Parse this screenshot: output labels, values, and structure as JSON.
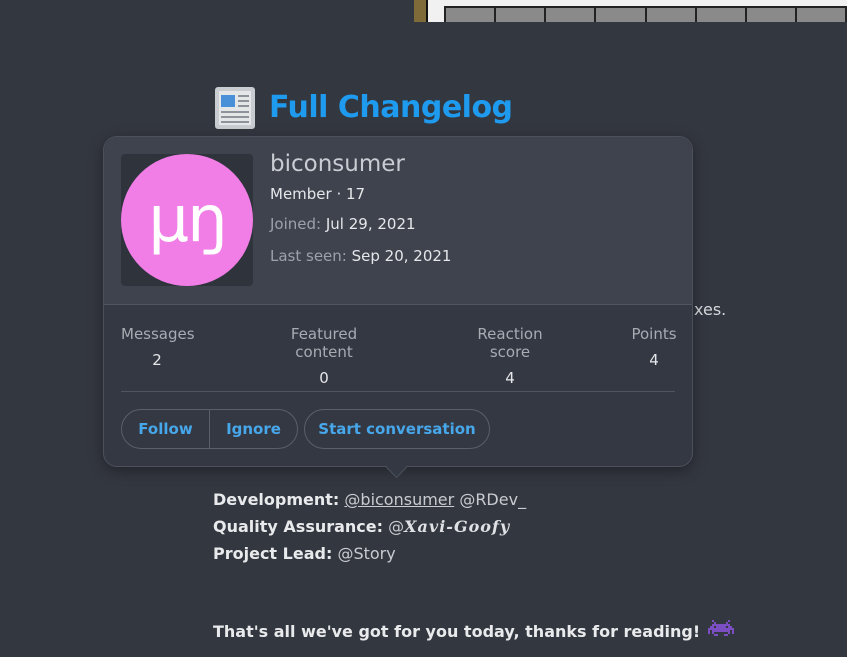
{
  "changelog": {
    "title": "Full Changelog",
    "icon": "newspaper-icon"
  },
  "background_text": {
    "fragment": "xes."
  },
  "profile_card": {
    "username": "biconsumer",
    "avatar_glyph": "μŋ",
    "avatar_color": "#f07ee6",
    "member_line": "Member · 17",
    "joined_label": "Joined:",
    "joined_value": "Jul 29, 2021",
    "last_seen_label": "Last seen:",
    "last_seen_value": "Sep 20, 2021",
    "stats": [
      {
        "label": "Messages",
        "value": "2"
      },
      {
        "label": "Featured content",
        "value": "0"
      },
      {
        "label": "Reaction score",
        "value": "4"
      },
      {
        "label": "Points",
        "value": "4"
      }
    ],
    "buttons": {
      "follow": "Follow",
      "ignore": "Ignore",
      "start_conversation": "Start conversation"
    },
    "accent_color": "#47a7eb"
  },
  "credits": {
    "development_label": "Development",
    "development_mention_1": "@biconsumer",
    "development_mention_2": "@RDev_",
    "qa_label": "Quality Assurance",
    "qa_mention_prefix": "@",
    "qa_mention_name": "Xavi-Goofy",
    "lead_label": "Project Lead",
    "lead_mention": "@Story"
  },
  "closing": {
    "text": "That's all we've got for you today, thanks for reading!",
    "icon": "space-invader-icon"
  }
}
